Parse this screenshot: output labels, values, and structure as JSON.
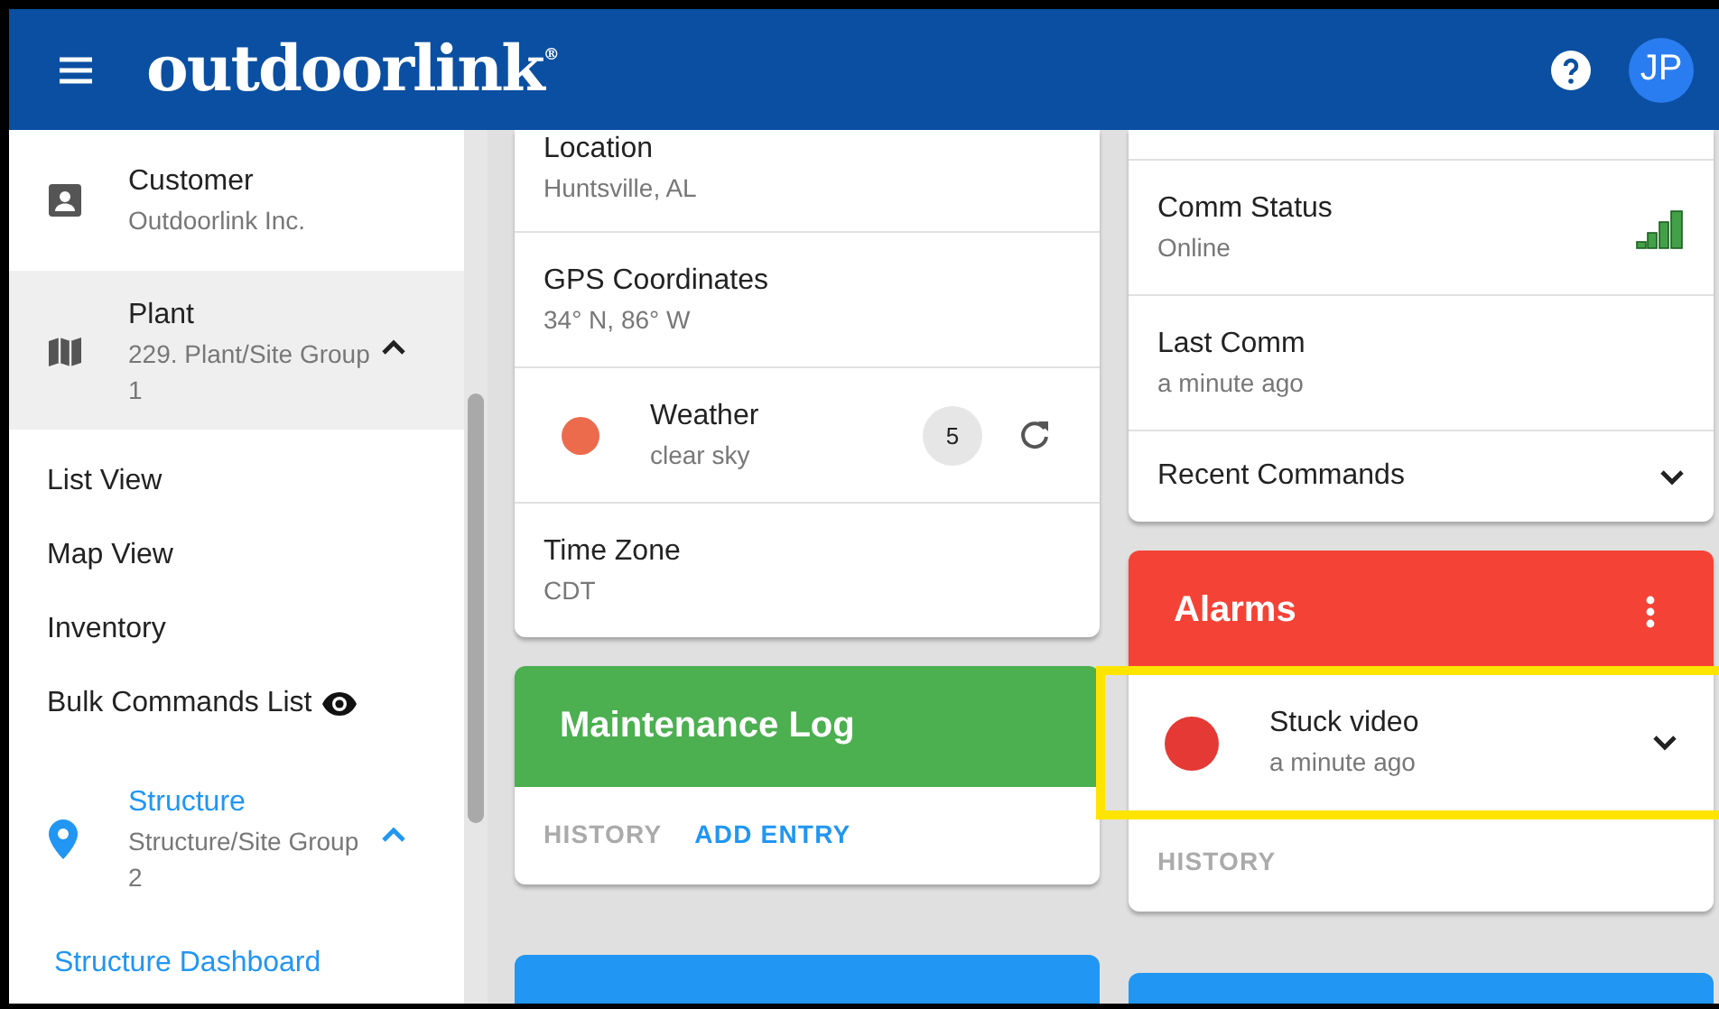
{
  "header": {
    "logo": "outdoorlink",
    "logo_mark": "®",
    "avatar": "JP"
  },
  "sidebar": {
    "items": [
      {
        "kind": "customer",
        "title": "Customer",
        "subtitle": "Outdoorlink Inc.",
        "selected": false,
        "current": false
      },
      {
        "kind": "plant",
        "title": "Plant",
        "subtitle": "229. Plant/Site Group 1",
        "selected": true,
        "current": false,
        "expanded": true
      },
      {
        "kind": "link",
        "label": "List View",
        "current": false
      },
      {
        "kind": "link",
        "label": "Map View",
        "current": false
      },
      {
        "kind": "link",
        "label": "Inventory",
        "current": false
      },
      {
        "kind": "preview_link",
        "label": "Bulk Commands List",
        "current": false
      },
      {
        "kind": "structure",
        "title": "Structure",
        "subtitle": "Structure/Site Group 2",
        "selected": false,
        "current": true,
        "expanded": true
      },
      {
        "kind": "link",
        "label": "Structure Dashboard",
        "current": true
      }
    ]
  },
  "columns": [
    {
      "cards": [
        {
          "kind": "list",
          "rows": [
            {
              "kind": "field",
              "title": "Location",
              "value": "Huntsville, AL"
            },
            {
              "kind": "field",
              "title": "GPS Coordinates",
              "value": "34° N, 86° W"
            },
            {
              "kind": "status",
              "title": "Weather",
              "value": "clear sky",
              "color": "#ec6b4c",
              "badge": "5"
            },
            {
              "kind": "field",
              "title": "Time Zone",
              "value": "CDT"
            }
          ]
        },
        {
          "kind": "action",
          "title": "Maintenance Log",
          "color": "#4caf50",
          "actions": [
            {
              "label": "HISTORY",
              "primary": false
            },
            {
              "label": "ADD ENTRY",
              "primary": true
            }
          ]
        },
        {
          "kind": "stub",
          "color": "#2196f3"
        }
      ]
    },
    {
      "cards": [
        {
          "kind": "list",
          "rows": [
            {
              "kind": "clipped"
            },
            {
              "kind": "signal",
              "title": "Comm Status",
              "value": "Online"
            },
            {
              "kind": "field",
              "title": "Last Comm",
              "value": "a minute ago"
            },
            {
              "kind": "expander",
              "title": "Recent Commands",
              "expanded": false
            }
          ]
        },
        {
          "kind": "alarms",
          "title": "Alarms",
          "color": "#f44336",
          "items": [
            {
              "title": "Stuck video",
              "time": "a minute ago",
              "color": "#e53935",
              "expanded": false,
              "highlighted": true
            }
          ],
          "actions": [
            {
              "label": "HISTORY",
              "primary": false
            }
          ]
        },
        {
          "kind": "stub",
          "color": "#2196f3"
        }
      ]
    }
  ]
}
